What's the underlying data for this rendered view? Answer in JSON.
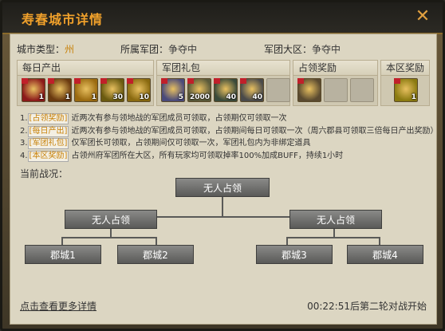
{
  "window": {
    "title": "寿春城市详情"
  },
  "info": {
    "city_type_label": "城市类型：",
    "city_type_value": "州",
    "legion_label": "所属军团：",
    "legion_value": "争夺中",
    "region_label": "军团大区：",
    "region_value": "争夺中"
  },
  "rewards": {
    "daily": {
      "title": "每日产出",
      "items": [
        {
          "name": "scroll-item",
          "count": "1",
          "color": "#8b1a1a"
        },
        {
          "name": "chest-item",
          "count": "1",
          "color": "#6a3a10"
        },
        {
          "name": "coin-item",
          "count": "1",
          "color": "#9a6a10"
        },
        {
          "name": "gold-pile-item",
          "count": "30",
          "color": "#6a5a10"
        },
        {
          "name": "gold-coin-item",
          "count": "10",
          "color": "#8a6a10"
        }
      ]
    },
    "legion": {
      "title": "军团礼包",
      "items": [
        {
          "name": "crystal-item",
          "count": "5",
          "color": "#4a4a7a"
        },
        {
          "name": "bread-item",
          "count": "2000",
          "color": "#5a5a3a"
        },
        {
          "name": "horse-item",
          "count": "40",
          "color": "#3a4a3a"
        },
        {
          "name": "glove-item",
          "count": "40",
          "color": "#4a4a4a"
        }
      ]
    },
    "occupy": {
      "title": "占领奖励",
      "items": [
        {
          "name": "trophy-item",
          "count": "",
          "color": "#5a4a30"
        }
      ]
    },
    "district": {
      "title": "本区奖励",
      "items": [
        {
          "name": "banner-item",
          "count": "1",
          "color": "#8a7a10"
        }
      ]
    }
  },
  "notes": [
    {
      "num": "1.",
      "tag": "[占领奖励]",
      "text": "近两次有参与领地战的军团成员可领取，占领期仅可领取一次"
    },
    {
      "num": "2.",
      "tag": "[每日产出]",
      "text": "近两次有参与领地战的军团成员可领取，占领期间每日可领取一次（周六郡县可领取三倍每日产出奖励）"
    },
    {
      "num": "3.",
      "tag": "[军团礼包]",
      "text": "仅军团长可领取，占领期间仅可领取一次，军团礼包内为非绑定道具"
    },
    {
      "num": "4.",
      "tag": "[本区奖励]",
      "text": "占领州府军团所在大区，所有玩家均可领取掉率100%加成BUFF，持续1小时"
    }
  ],
  "status_label": "当前战况：",
  "bracket": {
    "top": "无人占领",
    "left": "无人占领",
    "right": "无人占领",
    "c1": "郡城1",
    "c2": "郡城2",
    "c3": "郡城3",
    "c4": "郡城4"
  },
  "footer": {
    "link": "点击查看更多详情",
    "timer": "00:22:51后第二轮对战开始"
  },
  "colors": {
    "accent": "#f1a12b",
    "tag": "#c8820a"
  }
}
